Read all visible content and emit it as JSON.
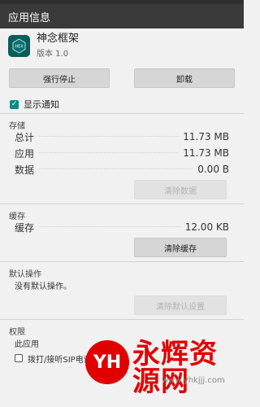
{
  "topbar": {
    "title": "应用信息"
  },
  "app": {
    "name": "神念框架",
    "version": "版本 1.0",
    "icon_name": "app-icon"
  },
  "buttons": {
    "force_stop": "强行停止",
    "uninstall": "卸载"
  },
  "notification": {
    "checked": true,
    "label": "显示通知"
  },
  "storage": {
    "title": "存储",
    "rows": [
      {
        "label": "总计",
        "value": "11.73 MB"
      },
      {
        "label": "应用",
        "value": "11.73 MB"
      },
      {
        "label": "数据",
        "value": "0.00 B"
      }
    ],
    "clear_data": "清除数据"
  },
  "cache": {
    "title": "缓存",
    "rows": [
      {
        "label": "缓存",
        "value": "12.00 KB"
      }
    ],
    "clear_cache": "清除缓存"
  },
  "default": {
    "title": "默认操作",
    "text": "没有默认操作。",
    "clear_defaults": "清除默认设置"
  },
  "permissions": {
    "title": "权限",
    "text": "此应用",
    "item_1": "拨打/接听SIP电话"
  },
  "watermark": {
    "logo_text": "YH",
    "title": "永辉资源网",
    "url": "www.yhkjjj.com"
  },
  "colors": {
    "titlebar": "#3a3a3a",
    "checkbox": "#0d8c86",
    "watermark": "#e00000"
  }
}
